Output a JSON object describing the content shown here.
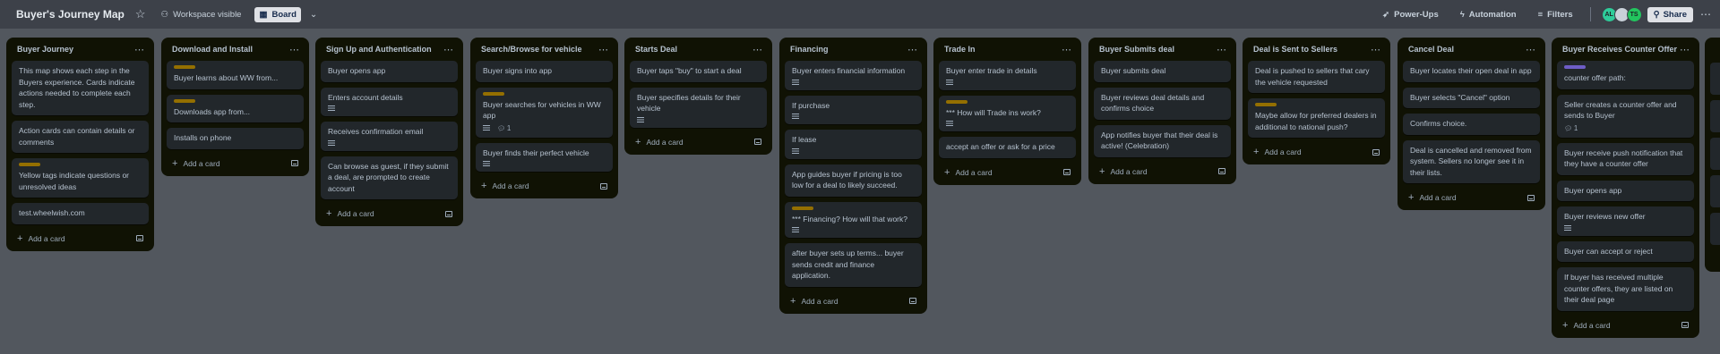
{
  "topbar": {
    "board_title": "Buyer's Journey Map",
    "star_icon": "star-icon",
    "visibility_label": "Workspace visible",
    "board_label": "Board",
    "power_ups_label": "Power-Ups",
    "automation_label": "Automation",
    "filters_label": "Filters",
    "avatars": [
      "AL",
      "",
      "TS"
    ],
    "share_label": "Share"
  },
  "add_card_label": "Add a card",
  "lists": [
    {
      "title": "Buyer Journey",
      "cards": [
        {
          "text": "This map shows each step in the Buyers experience. Cards indicate actions needed to complete each step."
        },
        {
          "text": "Action cards can contain details or comments"
        },
        {
          "label": "yellow",
          "text": "Yellow tags indicate questions or unresolved ideas"
        },
        {
          "text": "test.wheelwish.com"
        }
      ]
    },
    {
      "title": "Download and Install",
      "cards": [
        {
          "label": "yellow",
          "text": "Buyer learns about WW from..."
        },
        {
          "label": "yellow",
          "text": "Downloads app from..."
        },
        {
          "text": "Installs on phone"
        }
      ]
    },
    {
      "title": "Sign Up and Authentication",
      "cards": [
        {
          "text": "Buyer opens app"
        },
        {
          "text": "Enters account details",
          "desc": true
        },
        {
          "text": "Receives confirmation email",
          "desc": true
        },
        {
          "text": "Can browse as guest, if they submit a deal, are prompted to create account"
        }
      ]
    },
    {
      "title": "Search/Browse for vehicle",
      "cards": [
        {
          "text": "Buyer signs into app"
        },
        {
          "label": "yellow",
          "text": "Buyer searches for vehicles in WW app",
          "desc": true,
          "comments": "1"
        },
        {
          "text": "Buyer finds their perfect vehicle",
          "desc": true
        }
      ]
    },
    {
      "title": "Starts Deal",
      "cards": [
        {
          "text": "Buyer taps \"buy\" to start a deal"
        },
        {
          "text": "Buyer specifies details for their vehicle",
          "desc": true
        }
      ]
    },
    {
      "title": "Financing",
      "cards": [
        {
          "text": "Buyer enters financial information",
          "desc": true
        },
        {
          "text": "If purchase",
          "desc": true
        },
        {
          "text": "If lease",
          "desc": true
        },
        {
          "text": "App guides buyer if pricing is too low for a deal to likely succeed."
        },
        {
          "label": "yellow",
          "text": "*** Financing? How will that work?",
          "desc": true
        },
        {
          "text": "after buyer sets up terms... buyer sends credit and finance application."
        }
      ]
    },
    {
      "title": "Trade In",
      "cards": [
        {
          "text": "Buyer enter trade in details",
          "desc": true
        },
        {
          "label": "yellow",
          "text": "*** How will Trade ins work?",
          "desc": true
        },
        {
          "text": "accept an offer or ask for a price"
        }
      ]
    },
    {
      "title": "Buyer Submits deal",
      "cards": [
        {
          "text": "Buyer submits deal"
        },
        {
          "text": "Buyer reviews deal details and confirms choice"
        },
        {
          "text": "App notifies buyer that their deal is active! (Celebration)"
        }
      ]
    },
    {
      "title": "Deal is Sent to Sellers",
      "cards": [
        {
          "text": "Deal is pushed to sellers that cary the vehicle requested"
        },
        {
          "label": "yellow",
          "text": "Maybe allow for preferred dealers in additional to national push?"
        }
      ]
    },
    {
      "title": "Cancel Deal",
      "cards": [
        {
          "text": "Buyer locates their open deal in app"
        },
        {
          "text": "Buyer selects \"Cancel\" option"
        },
        {
          "text": "Confirms choice."
        },
        {
          "text": "Deal is cancelled and removed from system. Sellers no longer see it in their lists."
        }
      ]
    },
    {
      "title": "Buyer Receives Counter Offer",
      "cards": [
        {
          "label": "purple",
          "text": "counter offer path:"
        },
        {
          "text": "Seller creates a counter offer and sends to Buyer",
          "comments": "1"
        },
        {
          "text": "Buyer receive push notification that they have a counter offer"
        },
        {
          "text": "Buyer opens app"
        },
        {
          "text": "Buyer reviews new offer",
          "desc": true
        },
        {
          "text": "Buyer can accept or reject"
        },
        {
          "text": "If buyer has received multiple counter offers, they are listed on their deal page"
        }
      ]
    }
  ]
}
